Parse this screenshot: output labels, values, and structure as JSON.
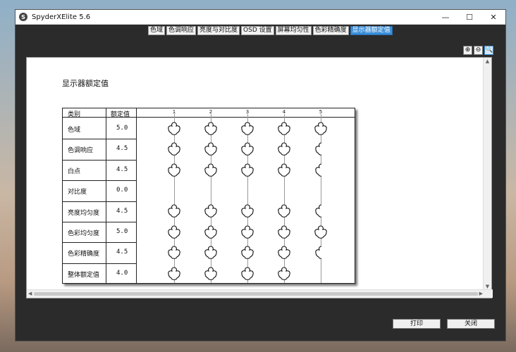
{
  "window": {
    "title": "SpyderXElite 5.6",
    "controls": [
      "—",
      "☐",
      "✕"
    ]
  },
  "app_icon": "S",
  "tabs": [
    {
      "label": "色域",
      "active": false
    },
    {
      "label": "色调响应",
      "active": false
    },
    {
      "label": "亮度与对比度",
      "active": false
    },
    {
      "label": "OSD 设置",
      "active": false
    },
    {
      "label": "屏幕均匀性",
      "active": false
    },
    {
      "label": "色彩精确度",
      "active": false
    },
    {
      "label": "显示器额定值",
      "active": true
    }
  ],
  "zoom": [
    {
      "icon": "zoom-in-icon",
      "glyph": "⊕"
    },
    {
      "icon": "zoom-out-icon",
      "glyph": "⊖"
    },
    {
      "icon": "zoom-fit-icon",
      "glyph": "🔍"
    }
  ],
  "report": {
    "title": "显示器额定值",
    "headers": {
      "category": "类别",
      "rating": "额定值"
    },
    "scale": [
      "1",
      "2",
      "3",
      "4",
      "5"
    ],
    "rows": [
      {
        "category": "色域",
        "rating": "5.0"
      },
      {
        "category": "色调响应",
        "rating": "4.5"
      },
      {
        "category": "白点",
        "rating": "4.5"
      },
      {
        "category": "对比度",
        "rating": "0.0"
      },
      {
        "category": "亮度均匀度",
        "rating": "4.5"
      },
      {
        "category": "色彩均匀度",
        "rating": "5.0"
      },
      {
        "category": "色彩精确度",
        "rating": "4.5"
      },
      {
        "category": "整体额定值",
        "rating": "4.0"
      }
    ]
  },
  "buttons": {
    "print": "打印",
    "close": "关闭"
  }
}
